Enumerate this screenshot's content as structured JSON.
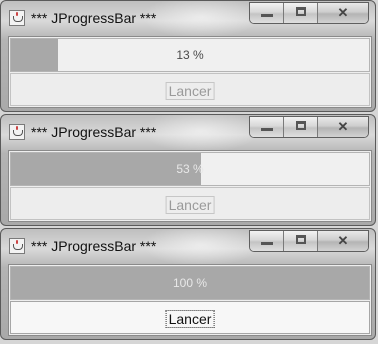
{
  "windows": [
    {
      "title": "*** JProgressBar ***",
      "progress": {
        "text": "13 %",
        "fraction": 0.13
      },
      "button": {
        "label": "Lancer",
        "enabled": false
      },
      "controls": {
        "minimize": "minimize-icon",
        "maximize": "maximize-icon",
        "close": "close-icon"
      }
    },
    {
      "title": "*** JProgressBar ***",
      "progress": {
        "text": "53 %",
        "fraction": 0.53
      },
      "button": {
        "label": "Lancer",
        "enabled": false
      },
      "controls": {
        "minimize": "minimize-icon",
        "maximize": "maximize-icon",
        "close": "close-icon"
      }
    },
    {
      "title": "*** JProgressBar ***",
      "progress": {
        "text": "100 %",
        "fraction": 1.0
      },
      "button": {
        "label": "Lancer",
        "enabled": true
      },
      "controls": {
        "minimize": "minimize-icon",
        "maximize": "maximize-icon",
        "close": "close-icon"
      }
    }
  ],
  "colors": {
    "progress_fill": "#a8a8a8",
    "progress_track": "#f0f0f0",
    "window_frame": "#b4b4b4"
  }
}
